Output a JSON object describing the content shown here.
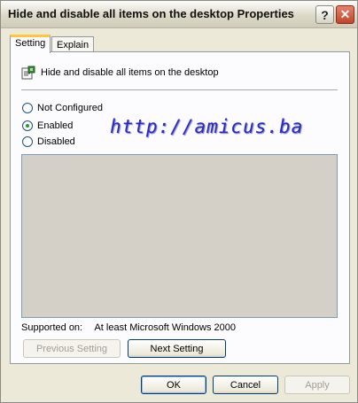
{
  "window": {
    "title": "Hide and disable all items on the desktop Properties",
    "help_label": "?",
    "close_label": "✕"
  },
  "tabs": [
    {
      "label": "Setting",
      "active": true
    },
    {
      "label": "Explain",
      "active": false
    }
  ],
  "policy": {
    "icon": "policy-setting-icon",
    "name": "Hide and disable all items on the desktop"
  },
  "options": [
    {
      "label": "Not Configured",
      "checked": false
    },
    {
      "label": "Enabled",
      "checked": true
    },
    {
      "label": "Disabled",
      "checked": false
    }
  ],
  "watermark": "http://amicus.ba",
  "supported": {
    "label": "Supported on:",
    "value": "At least Microsoft Windows 2000"
  },
  "nav_buttons": {
    "previous": "Previous Setting",
    "next": "Next Setting"
  },
  "dialog_buttons": {
    "ok": "OK",
    "cancel": "Cancel",
    "apply": "Apply"
  },
  "colors": {
    "dialog_bg": "#ece9d8",
    "tab_accent": "#ffc83c",
    "close_button": "#c0452a",
    "watermark": "#2a2ab8"
  }
}
